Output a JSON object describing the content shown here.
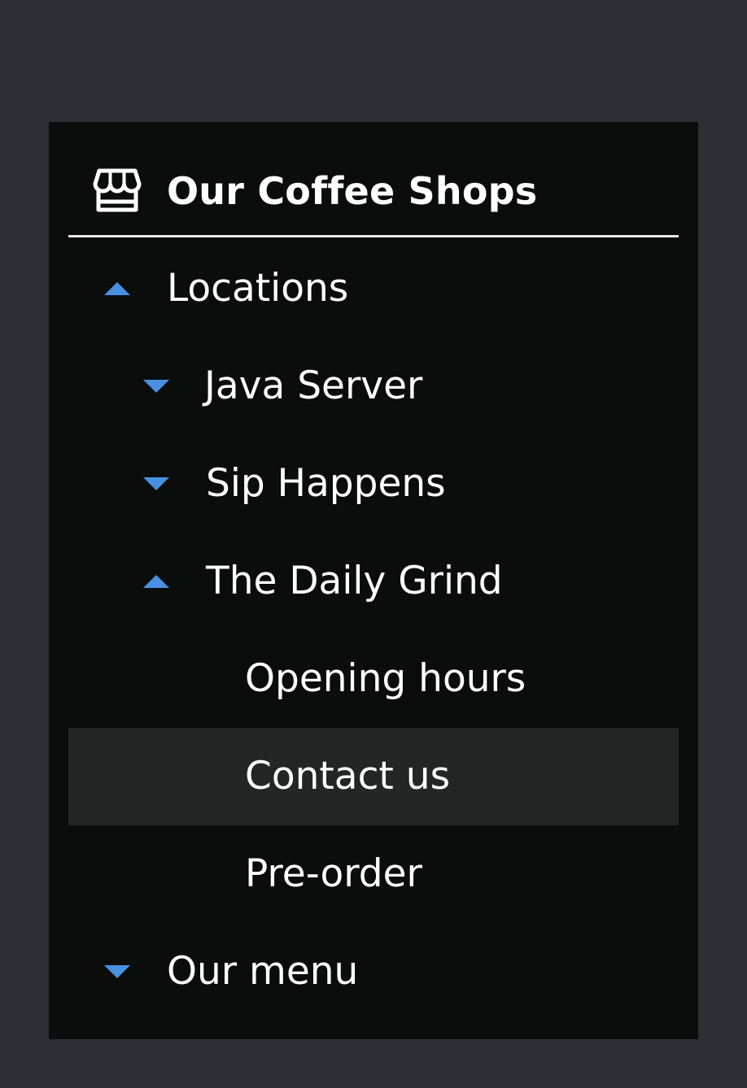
{
  "header": {
    "title": "Our Coffee Shops",
    "icon": "store-icon"
  },
  "tree": {
    "locations": {
      "label": "Locations",
      "expanded": true
    },
    "java_server": {
      "label": "Java Server",
      "expanded": false
    },
    "sip_happens": {
      "label": "Sip Happens",
      "expanded": false
    },
    "daily_grind": {
      "label": "The Daily Grind",
      "expanded": true
    },
    "opening_hours": {
      "label": "Opening hours"
    },
    "contact_us": {
      "label": "Contact us",
      "highlighted": true
    },
    "pre_order": {
      "label": "Pre-order"
    },
    "our_menu": {
      "label": "Our menu",
      "expanded": false
    }
  },
  "colors": {
    "page_background": "#2c2f34",
    "panel_background": "#0b0d0d",
    "highlight_background": "#242626",
    "caret_accent": "#4a90e2",
    "text": "#ffffff"
  }
}
